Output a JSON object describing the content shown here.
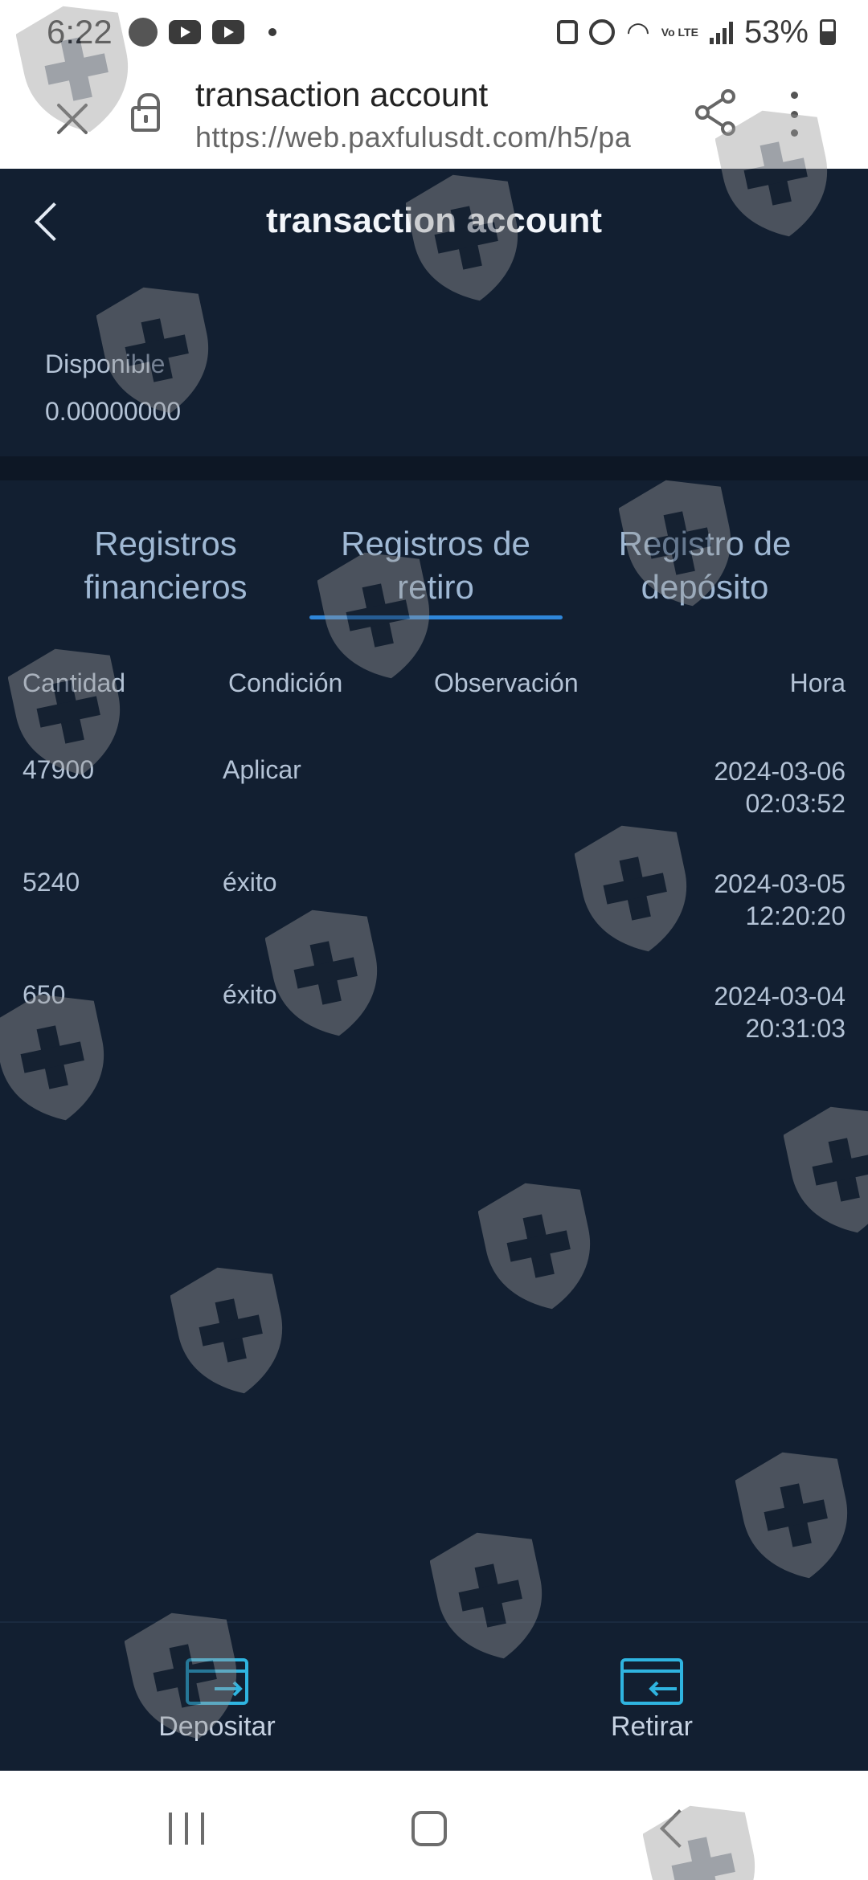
{
  "status_bar": {
    "time": "6:22",
    "battery_percent": "53%",
    "network_label": "Vo LTE"
  },
  "browser": {
    "title": "transaction account",
    "url": "https://web.paxfulusdt.com/h5/pa"
  },
  "app": {
    "title": "transaction account",
    "balance": {
      "label": "Disponible",
      "value": "0.00000000"
    },
    "tabs": [
      {
        "label": "Registros financieros",
        "active": false
      },
      {
        "label": "Registros de retiro",
        "active": true
      },
      {
        "label": "Registro de depósito",
        "active": false
      }
    ],
    "table": {
      "headers": [
        "Cantidad",
        "Condición",
        "Observación",
        "Hora"
      ],
      "rows": [
        {
          "amount": "47900",
          "status": "Aplicar",
          "note": "",
          "date": "2024-03-06",
          "time": "02:03:52"
        },
        {
          "amount": "5240",
          "status": "éxito",
          "note": "",
          "date": "2024-03-05",
          "time": "12:20:20"
        },
        {
          "amount": "650",
          "status": "éxito",
          "note": "",
          "date": "2024-03-04",
          "time": "20:31:03"
        }
      ]
    },
    "bottom_nav": {
      "deposit_label": "Depositar",
      "withdraw_label": "Retirar"
    }
  },
  "colors": {
    "app_background": "#121f31",
    "accent": "#2f86d9",
    "icon_cyan": "#2fb4e0"
  }
}
